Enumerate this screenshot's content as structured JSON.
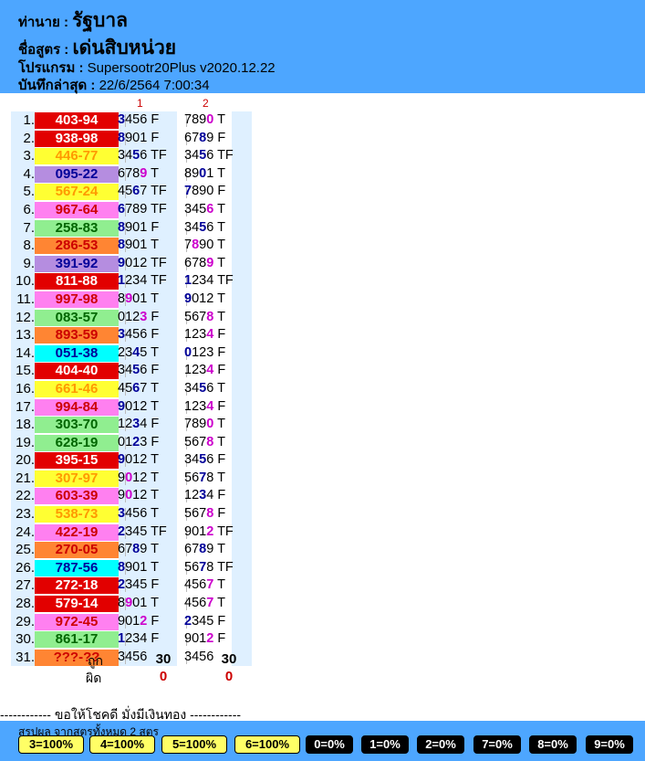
{
  "header": {
    "dealer_label": "ท่านาย :",
    "dealer_value": "รัฐบาล",
    "formula_label": "ชื่อสูตร :",
    "formula_value": "เด่นสิบหน่วย",
    "program_label": "โปรแกรม :",
    "program_value": "Supersootr20Plus v2020.12.22",
    "saved_label": "บันทึกล่าสุด :",
    "saved_value": "22/6/2564 7:00:34"
  },
  "column_numbers": [
    "1",
    "2"
  ],
  "colors": {
    "red": "#e20000",
    "yellow": "#ffff33",
    "purple": "#b58de0",
    "pink": "#ff80f0",
    "green": "#90ee90",
    "orange": "#ff8533",
    "cyan": "#00ffff",
    "digit_blue": "#000099",
    "digit_magenta": "#cc00cc",
    "header_bg": "#4da6ff"
  },
  "rows": [
    {
      "n": "1.",
      "result": "403-94",
      "color": "red",
      "c1": "3456 F",
      "c1b": [
        0
      ],
      "c2": "7890 T",
      "c2b": [
        3
      ]
    },
    {
      "n": "2.",
      "result": "938-98",
      "color": "red",
      "c1": "8901 F",
      "c1b": [
        0
      ],
      "c2": "6789 F",
      "c2b": [
        2
      ]
    },
    {
      "n": "3.",
      "result": "446-77",
      "color": "yellow",
      "c1": "3456 TF",
      "c1b": [
        2
      ],
      "c2": "3456 TF",
      "c2b": [
        2
      ]
    },
    {
      "n": "4.",
      "result": "095-22",
      "color": "purple",
      "c1": "6789 T",
      "c1b": [
        3
      ],
      "c2": "8901 T",
      "c2b": [
        2
      ]
    },
    {
      "n": "5.",
      "result": "567-24",
      "color": "yellow",
      "c1": "4567 TF",
      "c1b": [
        2
      ],
      "c2": "7890 F",
      "c2b": [
        0
      ]
    },
    {
      "n": "6.",
      "result": "967-64",
      "color": "pink",
      "c1": "6789 TF",
      "c1b": [
        0
      ],
      "c2": "3456 T",
      "c2b": [
        3
      ]
    },
    {
      "n": "7.",
      "result": "258-83",
      "color": "green",
      "c1": "8901 F",
      "c1b": [
        0
      ],
      "c2": "3456 T",
      "c2b": [
        2
      ]
    },
    {
      "n": "8.",
      "result": "286-53",
      "color": "orange",
      "c1": "8901 T",
      "c1b": [
        0
      ],
      "c2": "7890 T",
      "c2b": [
        1
      ]
    },
    {
      "n": "9.",
      "result": "391-92",
      "color": "purple",
      "c1": "9012 TF",
      "c1b": [
        0
      ],
      "c2": "6789 T",
      "c2b": [
        3
      ]
    },
    {
      "n": "10.",
      "result": "811-88",
      "color": "red",
      "c1": "1234 TF",
      "c1b": [
        0
      ],
      "c2": "1234 TF",
      "c2b": [
        0
      ]
    },
    {
      "n": "11.",
      "result": "997-98",
      "color": "pink",
      "c1": "8901 T",
      "c1b": [
        1
      ],
      "c2": "9012 T",
      "c2b": [
        0
      ]
    },
    {
      "n": "12.",
      "result": "083-57",
      "color": "green",
      "c1": "0123 F",
      "c1b": [
        3
      ],
      "c2": "5678 T",
      "c2b": [
        3
      ]
    },
    {
      "n": "13.",
      "result": "893-59",
      "color": "orange",
      "c1": "3456 F",
      "c1b": [
        0
      ],
      "c2": "1234 F",
      "c2b": [
        3
      ]
    },
    {
      "n": "14.",
      "result": "051-38",
      "color": "cyan",
      "c1": "2345 T",
      "c1b": [
        2
      ],
      "c2": "0123 F",
      "c2b": [
        0
      ]
    },
    {
      "n": "15.",
      "result": "404-40",
      "color": "red",
      "c1": "3456 F",
      "c1b": [
        2
      ],
      "c2": "1234 F",
      "c2b": [
        3
      ]
    },
    {
      "n": "16.",
      "result": "661-46",
      "color": "yellow",
      "c1": "4567 T",
      "c1b": [
        2
      ],
      "c2": "3456 T",
      "c2b": [
        2
      ]
    },
    {
      "n": "17.",
      "result": "994-84",
      "color": "pink",
      "c1": "9012 T",
      "c1b": [
        0
      ],
      "c2": "1234 F",
      "c2b": [
        3
      ]
    },
    {
      "n": "18.",
      "result": "303-70",
      "color": "green",
      "c1": "1234 F",
      "c1b": [
        2
      ],
      "c2": "7890 T",
      "c2b": [
        3
      ]
    },
    {
      "n": "19.",
      "result": "628-19",
      "color": "green",
      "c1": "0123 F",
      "c1b": [
        2
      ],
      "c2": "5678 T",
      "c2b": [
        3
      ]
    },
    {
      "n": "20.",
      "result": "395-15",
      "color": "red",
      "c1": "9012 T",
      "c1b": [
        0
      ],
      "c2": "3456 F",
      "c2b": [
        2
      ]
    },
    {
      "n": "21.",
      "result": "307-97",
      "color": "yellow",
      "c1": "9012 T",
      "c1b": [
        1
      ],
      "c2": "5678 T",
      "c2b": [
        2
      ]
    },
    {
      "n": "22.",
      "result": "603-39",
      "color": "pink",
      "c1": "9012 T",
      "c1b": [
        1
      ],
      "c2": "1234 F",
      "c2b": [
        2
      ]
    },
    {
      "n": "23.",
      "result": "538-73",
      "color": "yellow",
      "c1": "3456 T",
      "c1b": [
        0
      ],
      "c2": "5678 F",
      "c2b": [
        3
      ]
    },
    {
      "n": "24.",
      "result": "422-19",
      "color": "pink",
      "c1": "2345 TF",
      "c1b": [
        0
      ],
      "c2": "9012 TF",
      "c2b": [
        3
      ]
    },
    {
      "n": "25.",
      "result": "270-05",
      "color": "orange",
      "c1": "6789 T",
      "c1b": [
        2
      ],
      "c2": "6789 T",
      "c2b": [
        2
      ]
    },
    {
      "n": "26.",
      "result": "787-56",
      "color": "cyan",
      "c1": "8901 T",
      "c1b": [
        0
      ],
      "c2": "5678 TF",
      "c2b": [
        2
      ]
    },
    {
      "n": "27.",
      "result": "272-18",
      "color": "red",
      "c1": "2345 F",
      "c1b": [
        0
      ],
      "c2": "4567 T",
      "c2b": [
        3
      ]
    },
    {
      "n": "28.",
      "result": "579-14",
      "color": "red",
      "c1": "8901 T",
      "c1b": [
        1
      ],
      "c2": "4567 T",
      "c2b": [
        3
      ]
    },
    {
      "n": "29.",
      "result": "972-45",
      "color": "pink",
      "c1": "9012 F",
      "c1b": [
        3
      ],
      "c2": "2345 F",
      "c2b": [
        0
      ]
    },
    {
      "n": "30.",
      "result": "861-17",
      "color": "green",
      "c1": "1234 F",
      "c1b": [
        0
      ],
      "c2": "9012 F",
      "c2b": [
        3
      ]
    },
    {
      "n": "31.",
      "result": "???-??",
      "color": "orange",
      "c1": "3456",
      "c1b": [],
      "c2": "3456",
      "c2b": []
    }
  ],
  "summary": {
    "correct_label": "ถูก",
    "wrong_label": "ผิด",
    "correct": [
      "30",
      "30"
    ],
    "wrong": [
      "0",
      "0"
    ]
  },
  "divider_text": "------------ ขอให้โชคดี มั่งมีเงินทอง ------------",
  "footer": {
    "title": "สรุปผล  จากสูตรทั้งหมด 2 สูตร",
    "badges": [
      {
        "label": "3=100%",
        "style": "yellow"
      },
      {
        "label": "4=100%",
        "style": "yellow"
      },
      {
        "label": "5=100%",
        "style": "yellow"
      },
      {
        "label": "6=100%",
        "style": "yellow"
      },
      {
        "label": "0=0%",
        "style": "dark"
      },
      {
        "label": "1=0%",
        "style": "dark"
      },
      {
        "label": "2=0%",
        "style": "dark"
      },
      {
        "label": "7=0%",
        "style": "dark"
      },
      {
        "label": "8=0%",
        "style": "dark"
      },
      {
        "label": "9=0%",
        "style": "dark"
      }
    ]
  }
}
